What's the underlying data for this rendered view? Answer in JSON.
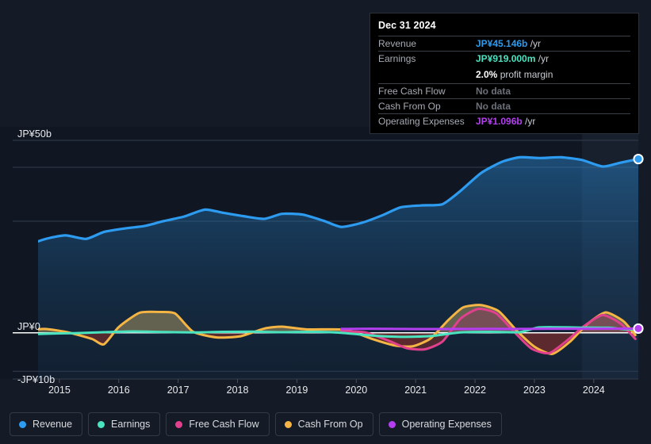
{
  "axes": {
    "y_ticks": [
      {
        "label": "JP¥50b",
        "value": 50
      },
      {
        "label": "JP¥0",
        "value": 0
      },
      {
        "label": "-JP¥10b",
        "value": -10
      }
    ],
    "x_ticks": [
      "2015",
      "2016",
      "2017",
      "2018",
      "2019",
      "2020",
      "2021",
      "2022",
      "2023",
      "2024"
    ]
  },
  "tooltip": {
    "date": "Dec 31 2024",
    "rows": [
      {
        "key": "Revenue",
        "amount": "JP¥45.146b",
        "unit": "/yr",
        "color": "#2d9bf0",
        "nodata": false
      },
      {
        "key": "Earnings",
        "amount": "JP¥919.000m",
        "unit": "/yr",
        "color": "#4ae3c0",
        "nodata": false
      },
      {
        "key": "Free Cash Flow",
        "amount": "No data",
        "unit": "",
        "color": "#6b7079",
        "nodata": true
      },
      {
        "key": "Cash From Op",
        "amount": "No data",
        "unit": "",
        "color": "#6b7079",
        "nodata": true
      },
      {
        "key": "Operating Expenses",
        "amount": "JP¥1.096b",
        "unit": "/yr",
        "color": "#b43ff0",
        "nodata": false
      }
    ],
    "margin_value": "2.0%",
    "margin_text": "profit margin"
  },
  "legend": {
    "items": [
      {
        "label": "Revenue",
        "color": "#2d9bf0"
      },
      {
        "label": "Earnings",
        "color": "#4ae3c0"
      },
      {
        "label": "Free Cash Flow",
        "color": "#e0408d"
      },
      {
        "label": "Cash From Op",
        "color": "#f5b545"
      },
      {
        "label": "Operating Expenses",
        "color": "#b43ff0"
      }
    ]
  },
  "chart_data": {
    "type": "area",
    "title": "",
    "xlabel": "",
    "ylabel": "JP¥",
    "currency": "JP¥",
    "unit": "billions",
    "ylim": [
      -12.0,
      53.5
    ],
    "xlim": [
      2014.25,
      2025.0
    ],
    "grid": true,
    "gridlines_y": [
      50,
      43,
      29,
      0,
      -10
    ],
    "zero_line": 0,
    "legend_position": "bottom-left",
    "forecast_band": {
      "start_x": 2024.05,
      "end_x": 2025.0,
      "label": ""
    },
    "endpoints": [
      {
        "series": "Revenue",
        "x": 2025.0,
        "y": 45.146,
        "color": "#2d9bf0"
      },
      {
        "series": "Operating Expenses",
        "x": 2025.0,
        "y": 1.096,
        "color": "#b43ff0"
      }
    ],
    "series": [
      {
        "name": "Revenue",
        "color": "#2d9bf0",
        "fill": true,
        "x": [
          2014.25,
          2014.6,
          2015.0,
          2015.35,
          2015.7,
          2016.0,
          2016.35,
          2016.7,
          2017.0,
          2017.35,
          2017.7,
          2018.0,
          2018.35,
          2018.7,
          2019.0,
          2019.35,
          2019.7,
          2020.0,
          2020.35,
          2020.7,
          2021.0,
          2021.35,
          2021.7,
          2022.0,
          2022.35,
          2022.7,
          2023.0,
          2023.35,
          2023.7,
          2024.05,
          2024.4,
          2024.7,
          2025.0
        ],
        "y": [
          19.0,
          22.0,
          24.3,
          25.3,
          24.4,
          26.2,
          27.1,
          27.8,
          29.0,
          30.2,
          32.0,
          31.2,
          30.3,
          29.6,
          30.9,
          30.7,
          29.1,
          27.5,
          28.6,
          30.6,
          32.6,
          33.1,
          33.4,
          36.8,
          41.5,
          44.4,
          45.6,
          45.4,
          45.6,
          44.9,
          43.2,
          44.2,
          45.146
        ]
      },
      {
        "name": "Earnings",
        "color": "#4ae3c0",
        "fill": false,
        "x": [
          2014.25,
          2014.6,
          2015.0,
          2015.5,
          2016.0,
          2016.5,
          2017.0,
          2017.5,
          2018.0,
          2018.5,
          2019.0,
          2019.5,
          2020.0,
          2020.5,
          2021.0,
          2021.5,
          2022.0,
          2022.5,
          2023.0,
          2023.3,
          2023.6,
          2024.05,
          2024.5,
          2024.75,
          2025.0
        ],
        "y": [
          -1.1,
          -0.6,
          -0.25,
          -0.1,
          0.15,
          0.35,
          0.2,
          0.1,
          0.25,
          0.3,
          0.15,
          0.25,
          0.0,
          -0.7,
          -1.05,
          -0.85,
          0.1,
          0.25,
          0.15,
          1.35,
          1.45,
          1.35,
          1.3,
          0.95,
          0.919
        ]
      },
      {
        "name": "Free Cash Flow",
        "color": "#e0408d",
        "fill": true,
        "x": [
          2020.0,
          2020.4,
          2020.8,
          2021.1,
          2021.4,
          2021.7,
          2022.0,
          2022.3,
          2022.6,
          2022.9,
          2023.2,
          2023.5,
          2023.8,
          2024.1,
          2024.4,
          2024.7,
          2024.95
        ],
        "y": [
          0.4,
          0.1,
          -2.1,
          -4.0,
          -4.3,
          -2.3,
          3.6,
          6.2,
          5.1,
          0.4,
          -4.1,
          -5.3,
          -2.0,
          1.9,
          4.6,
          2.4,
          -1.6
        ]
      },
      {
        "name": "Cash From Op",
        "color": "#f5b545",
        "fill": true,
        "x": [
          2014.25,
          2014.6,
          2015.0,
          2015.4,
          2015.8,
          2016.0,
          2016.25,
          2016.6,
          2016.95,
          2017.2,
          2017.5,
          2017.9,
          2018.3,
          2018.7,
          2019.0,
          2019.4,
          2019.8,
          2020.1,
          2020.5,
          2020.9,
          2021.2,
          2021.5,
          2021.8,
          2022.05,
          2022.35,
          2022.65,
          2022.95,
          2023.25,
          2023.55,
          2023.85,
          2024.15,
          2024.45,
          2024.75,
          2024.95
        ],
        "y": [
          -0.6,
          0.4,
          1.0,
          0.1,
          -1.6,
          -3.0,
          1.5,
          5.2,
          5.4,
          5.0,
          0.3,
          -1.2,
          -0.9,
          1.1,
          1.6,
          0.9,
          0.9,
          0.7,
          -1.5,
          -3.3,
          -3.5,
          -1.5,
          3.3,
          6.6,
          7.2,
          5.6,
          0.6,
          -3.6,
          -5.5,
          -2.3,
          2.4,
          5.3,
          3.0,
          -0.6
        ]
      },
      {
        "name": "Operating Expenses",
        "color": "#b43ff0",
        "fill": false,
        "x": [
          2020.0,
          2020.5,
          2021.0,
          2021.5,
          2022.0,
          2022.5,
          2023.0,
          2023.5,
          2024.0,
          2024.5,
          2025.0
        ],
        "y": [
          1.0,
          1.05,
          1.0,
          0.98,
          1.0,
          1.02,
          1.0,
          1.05,
          1.05,
          1.08,
          1.096
        ]
      }
    ]
  }
}
